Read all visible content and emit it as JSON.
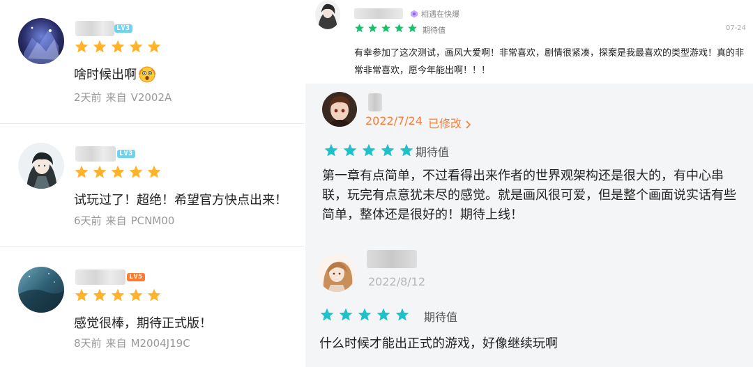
{
  "colors": {
    "orange_star": "#ffb22a",
    "green_star": "#15c26b",
    "teal_star": "#1ec1c9",
    "accent_orange": "#ff7a33",
    "meta_gray": "#999999"
  },
  "left_reviews": [
    {
      "level": "LV3",
      "rating": 5,
      "text": "啥时候出啊",
      "emoji": "shocked-face-emoji",
      "time": "2天前",
      "from": "来自",
      "device": "V2002A"
    },
    {
      "level": "LV3",
      "rating": 5,
      "text": "试玩过了！超绝！希望官方快点出来！",
      "time": "6天前",
      "from": "来自",
      "device": "PCNM00"
    },
    {
      "level": "LV5",
      "rating": 5,
      "text": "感觉很棒，期待正式版！",
      "time": "8天前",
      "from": "来自",
      "device": "M2004J19C"
    }
  ],
  "right_top_review": {
    "meet_label": "相遇在快爆",
    "rating": 5,
    "status": "期待值",
    "date": "07-24",
    "text": "有幸参加了这次测试，画风大爱啊！非常喜欢，剧情很紧凑，探案是我最喜欢的类型游戏！真的非常非常喜欢，愿今年能出啊！！！"
  },
  "right_reviews": [
    {
      "date": "2022/7/24",
      "edited": "已修改",
      "rating": 5,
      "status": "期待值",
      "text": "第一章有点简单，不过看得出来作者的世界观架构还是很大的，有中心串联，玩完有点意犹未尽的感觉。就是画风很可爱，但是整个画面说实话有些简单，整体还是很好的！期待上线！"
    },
    {
      "date": "2022/8/12",
      "rating": 5,
      "status": "期待值",
      "text": "什么时候才能出正式的游戏，好像继续玩啊"
    }
  ]
}
